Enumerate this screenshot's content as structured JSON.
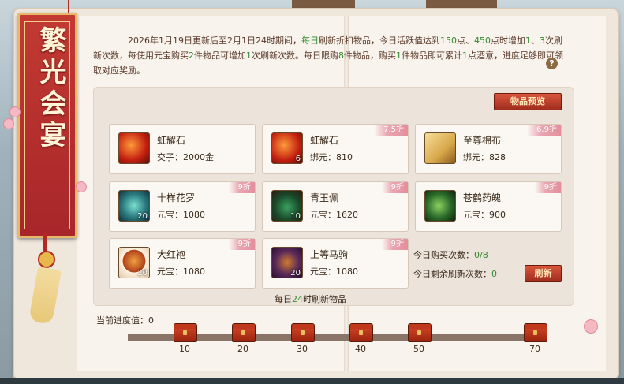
{
  "banner": {
    "title": "繁光会宴"
  },
  "intro": {
    "p1": "2026年1月19日更新后至2月1日24时期间，",
    "p2": "每日",
    "p3": "刷新折扣物品，今日活跃值达到",
    "p4": "150",
    "p5": "点、",
    "p6": "450",
    "p7": "点时增加",
    "p8": "1",
    "p9": "、",
    "p10": "3",
    "p11": "次刷新次数，每使用元宝购买",
    "p12": "2",
    "p13": "件物品可增加",
    "p14": "1",
    "p15": "次刷新次数。每日限购",
    "p16": "8",
    "p17": "件物品，购买",
    "p18": "1",
    "p19": "件物品即可累计",
    "p20": "1",
    "p21": "点酒意，进度足够即可领取对应奖励。"
  },
  "help": {
    "label": "?"
  },
  "preview_button": {
    "label": "物品预览"
  },
  "items": [
    {
      "name": "虹耀石",
      "price": "交子：2000金",
      "qty": "",
      "discount": "",
      "icon": "rainbow-stone-icon"
    },
    {
      "name": "虹耀石",
      "price": "绑元：810",
      "qty": "6",
      "discount": "7.5折",
      "icon": "rainbow-stone-icon"
    },
    {
      "name": "至尊棉布",
      "price": "绑元：828",
      "qty": "",
      "discount": "6.9折",
      "icon": "cotton-cloth-icon"
    },
    {
      "name": "十样花罗",
      "price": "元宝：1080",
      "qty": "20",
      "discount": "9折",
      "icon": "flower-silk-icon"
    },
    {
      "name": "青玉佩",
      "price": "元宝：1620",
      "qty": "10",
      "discount": "9折",
      "icon": "jade-pendant-icon"
    },
    {
      "name": "苍鹤药魄",
      "price": "元宝：900",
      "qty": "",
      "discount": "9折",
      "icon": "crane-potion-icon"
    },
    {
      "name": "大红袍",
      "price": "元宝：1080",
      "qty": "20",
      "discount": "9折",
      "icon": "tea-cup-icon"
    },
    {
      "name": "上等马驹",
      "price": "元宝：1080",
      "qty": "20",
      "discount": "9折",
      "icon": "horse-icon"
    }
  ],
  "status": {
    "buy_label": "今日购买次数：",
    "buy_value": "0/8",
    "refresh_label": "今日剩余刷新次数：",
    "refresh_value": "0"
  },
  "refresh_button": {
    "label": "刷新"
  },
  "daily_note": {
    "pre": "每日",
    "num": "24",
    "post": "时刷新物品"
  },
  "progress": {
    "label": "当前进度值：0",
    "value": 0,
    "milestones": [
      "10",
      "20",
      "30",
      "40",
      "50",
      "70"
    ]
  },
  "colors": {
    "accent_green": "#2f8a2a",
    "banner_red": "#b32a22",
    "button_red": "#a02d1e",
    "discount_pink": "#e48e9c"
  }
}
